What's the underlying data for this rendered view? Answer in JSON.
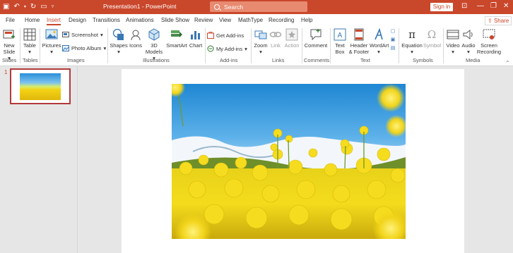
{
  "window": {
    "title": "Presentation1  -  PowerPoint",
    "sign_in": "Sign in",
    "minimize": "—",
    "restore": "❐",
    "close": "✕"
  },
  "search": {
    "placeholder": "Search"
  },
  "menu": {
    "tabs": [
      "File",
      "Home",
      "Insert",
      "Design",
      "Transitions",
      "Animations",
      "Slide Show",
      "Review",
      "View",
      "MathType",
      "Recording",
      "Help"
    ],
    "active": "Insert",
    "share": "Share"
  },
  "ribbon": {
    "slides": {
      "new_slide_line1": "New",
      "new_slide_line2": "Slide",
      "label": "Slides"
    },
    "tables": {
      "table": "Table",
      "label": "Tables"
    },
    "images": {
      "pictures": "Pictures",
      "screenshot": "Screenshot",
      "photo_album": "Photo Album",
      "label": "Images"
    },
    "illustrations": {
      "shapes": "Shapes",
      "icons": "Icons",
      "models_line1": "3D",
      "models_line2": "Models",
      "smartart": "SmartArt",
      "chart": "Chart",
      "label": "Illustrations"
    },
    "addins": {
      "get_addins": "Get Add-ins",
      "my_addins": "My Add-ins",
      "label": "Add-ins"
    },
    "links": {
      "zoom": "Zoom",
      "link": "Link",
      "action": "Action",
      "label": "Links"
    },
    "comments": {
      "comment": "Comment",
      "label": "Comments"
    },
    "text": {
      "textbox_line1": "Text",
      "textbox_line2": "Box",
      "header_line1": "Header",
      "header_line2": "& Footer",
      "wordart": "WordArt",
      "label": "Text"
    },
    "symbols": {
      "equation": "Equation",
      "symbol": "Symbol",
      "label": "Symbols"
    },
    "media": {
      "video": "Video",
      "audio": "Audio",
      "screen_rec_line1": "Screen",
      "screen_rec_line2": "Recording",
      "label": "Media"
    }
  },
  "slides_panel": {
    "slide_number": "1"
  },
  "colors": {
    "accent": "#c9472b",
    "ribbon_bg": "#ffffff",
    "workspace": "#e6e6e6"
  }
}
